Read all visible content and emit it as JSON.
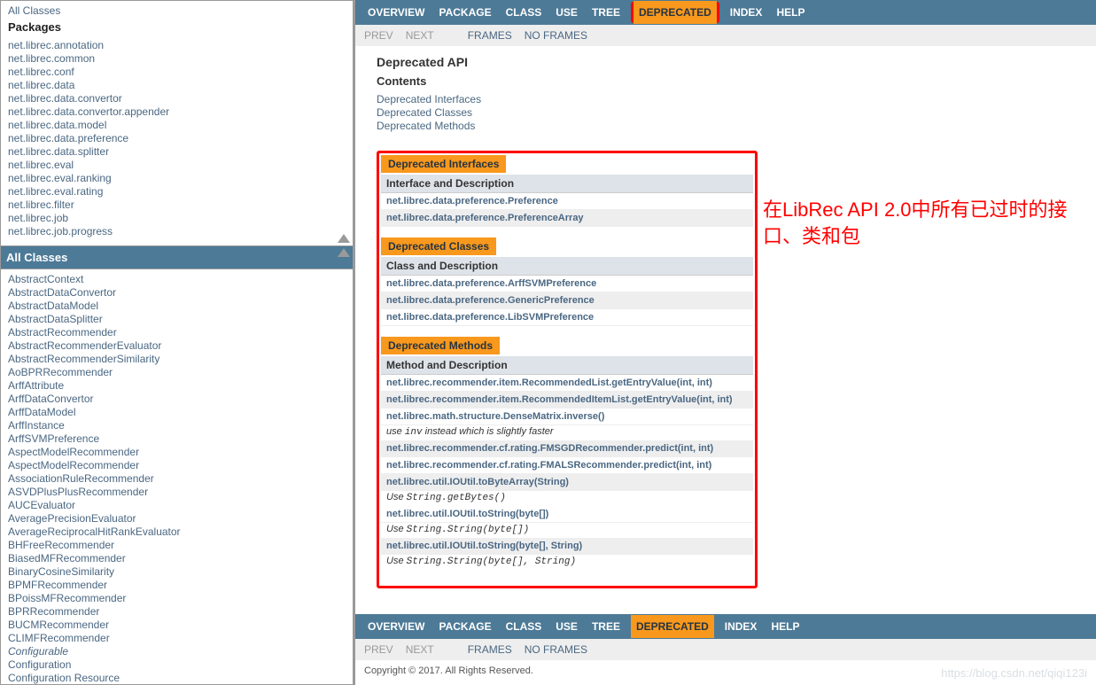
{
  "left": {
    "allClassesTop": "All Classes",
    "packagesHeading": "Packages",
    "packages": [
      "net.librec.annotation",
      "net.librec.common",
      "net.librec.conf",
      "net.librec.data",
      "net.librec.data.convertor",
      "net.librec.data.convertor.appender",
      "net.librec.data.model",
      "net.librec.data.preference",
      "net.librec.data.splitter",
      "net.librec.eval",
      "net.librec.eval.ranking",
      "net.librec.eval.rating",
      "net.librec.filter",
      "net.librec.job",
      "net.librec.job.progress"
    ],
    "allClassesBar": "All Classes",
    "classes": [
      "AbstractContext",
      "AbstractDataConvertor",
      "AbstractDataModel",
      "AbstractDataSplitter",
      "AbstractRecommender",
      "AbstractRecommenderEvaluator",
      "AbstractRecommenderSimilarity",
      "AoBPRRecommender",
      "ArffAttribute",
      "ArffDataConvertor",
      "ArffDataModel",
      "ArffInstance",
      "ArffSVMPreference",
      "AspectModelRecommender",
      "AspectModelRecommender",
      "AssociationRuleRecommender",
      "ASVDPlusPlusRecommender",
      "AUCEvaluator",
      "AveragePrecisionEvaluator",
      "AverageReciprocalHitRankEvaluator",
      "BHFreeRecommender",
      "BiasedMFRecommender",
      "BinaryCosineSimilarity",
      "BPMFRecommender",
      "BPoissMFRecommender",
      "BPRRecommender",
      "BUCMRecommender",
      "CLIMFRecommender",
      "Configurable",
      "Configuration",
      "Configuration Resource"
    ]
  },
  "nav": {
    "items": [
      "OVERVIEW",
      "PACKAGE",
      "CLASS",
      "USE",
      "TREE",
      "DEPRECATED",
      "INDEX",
      "HELP"
    ],
    "active": "DEPRECATED",
    "sub": {
      "prev": "PREV",
      "next": "NEXT",
      "frames": "FRAMES",
      "noframes": "NO FRAMES"
    }
  },
  "main": {
    "title": "Deprecated API",
    "contentsLabel": "Contents",
    "contents": [
      "Deprecated Interfaces",
      "Deprecated Classes",
      "Deprecated Methods"
    ],
    "annotation": "在LibRec API 2.0中所有已过时的接口、类和包",
    "sections": [
      {
        "caption": "Deprecated Interfaces",
        "header": "Interface and Description",
        "rows": [
          {
            "text": "net.librec.data.preference.Preference"
          },
          {
            "text": "net.librec.data.preference.PreferenceArray"
          }
        ]
      },
      {
        "caption": "Deprecated Classes",
        "header": "Class and Description",
        "rows": [
          {
            "text": "net.librec.data.preference.ArffSVMPreference"
          },
          {
            "text": "net.librec.data.preference.GenericPreference"
          },
          {
            "text": "net.librec.data.preference.LibSVMPreference"
          }
        ]
      },
      {
        "caption": "Deprecated Methods",
        "header": "Method and Description",
        "rows": [
          {
            "text": "net.librec.recommender.item.RecommendedList.getEntryValue(int, int)"
          },
          {
            "text": "net.librec.recommender.item.RecommendedItemList.getEntryValue(int, int)"
          },
          {
            "text": "net.librec.math.structure.DenseMatrix.inverse()",
            "sub_pre": "use ",
            "sub_code": "inv",
            "sub_post": " instead which is slightly faster"
          },
          {
            "text": "net.librec.recommender.cf.rating.FMSGDRecommender.predict(int, int)"
          },
          {
            "text": "net.librec.recommender.cf.rating.FMALSRecommender.predict(int, int)"
          },
          {
            "text": "net.librec.util.IOUtil.toByteArray(String)",
            "sub_pre": "Use ",
            "sub_code": "String.getBytes()"
          },
          {
            "text": "net.librec.util.IOUtil.toString(byte[])",
            "sub_pre": "Use ",
            "sub_code": "String.String(byte[])"
          },
          {
            "text": "net.librec.util.IOUtil.toString(byte[], String)",
            "sub_pre": "Use ",
            "sub_code": "String.String(byte[], String)"
          }
        ]
      }
    ]
  },
  "footer": {
    "copyright": "Copyright © 2017. All Rights Reserved.",
    "watermark": "https://blog.csdn.net/qiqi123i"
  }
}
